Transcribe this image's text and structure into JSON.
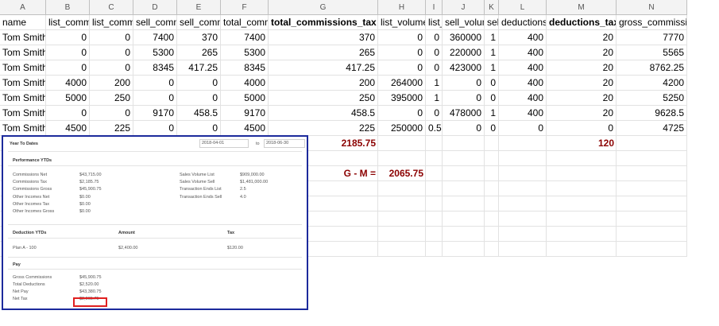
{
  "columns": [
    "A",
    "B",
    "C",
    "D",
    "E",
    "F",
    "G",
    "H",
    "I",
    "J",
    "K",
    "L",
    "M",
    "N"
  ],
  "header_row": [
    "name",
    "list_comm",
    "list_comm",
    "sell_comm",
    "sell_comm",
    "total_comm",
    "total_commissions_tax",
    "list_volume",
    "list_",
    "sell_volume",
    "sell_",
    "deductions",
    "deductions_tax",
    "gross_commission"
  ],
  "rows": [
    [
      "Tom Smith",
      "0",
      "0",
      "7400",
      "370",
      "7400",
      "370",
      "0",
      "0",
      "360000",
      "1",
      "400",
      "20",
      "7770"
    ],
    [
      "Tom Smith",
      "0",
      "0",
      "5300",
      "265",
      "5300",
      "265",
      "0",
      "0",
      "220000",
      "1",
      "400",
      "20",
      "5565"
    ],
    [
      "Tom Smith",
      "0",
      "0",
      "8345",
      "417.25",
      "8345",
      "417.25",
      "0",
      "0",
      "423000",
      "1",
      "400",
      "20",
      "8762.25"
    ],
    [
      "Tom Smith",
      "4000",
      "200",
      "0",
      "0",
      "4000",
      "200",
      "264000",
      "1",
      "0",
      "0",
      "400",
      "20",
      "4200"
    ],
    [
      "Tom Smith",
      "5000",
      "250",
      "0",
      "0",
      "5000",
      "250",
      "395000",
      "1",
      "0",
      "0",
      "400",
      "20",
      "5250"
    ],
    [
      "Tom Smith",
      "0",
      "0",
      "9170",
      "458.5",
      "9170",
      "458.5",
      "0",
      "0",
      "478000",
      "1",
      "400",
      "20",
      "9628.5"
    ],
    [
      "Tom Smith",
      "4500",
      "225",
      "0",
      "0",
      "4500",
      "225",
      "250000",
      "0.5",
      "0",
      "0",
      "0",
      "0",
      "4725"
    ]
  ],
  "sum_tax": "2185.75",
  "sum_deductions_tax": "120",
  "gm_label": "G - M =",
  "gm_value": "2065.75",
  "panel": {
    "title": "Year To Dates",
    "date_from": "2018-04-01",
    "to_label": "to",
    "date_to": "2018-06-30",
    "perf_title": "Performance YTDs",
    "perf_left": [
      {
        "label": "Commissions Net",
        "value": "$43,715.00"
      },
      {
        "label": "Commissions Tax",
        "value": "$2,185.75"
      },
      {
        "label": "Commissions Gross",
        "value": "$45,900.75"
      },
      {
        "label": "Other Incomes Net",
        "value": "$0.00"
      },
      {
        "label": "Other Incomes Tax",
        "value": "$0.00"
      },
      {
        "label": "Other Incomes Gross",
        "value": "$0.00"
      }
    ],
    "perf_right": [
      {
        "label": "Sales Volume List",
        "value": "$909,000.00"
      },
      {
        "label": "Sales Volume Sell",
        "value": "$1,481,000.00"
      },
      {
        "label": "Transaction Ends List",
        "value": "2.5"
      },
      {
        "label": "Transaction Ends Sell",
        "value": "4.0"
      }
    ],
    "ded_title": "Deduction YTDs",
    "ded_amount_header": "Amount",
    "ded_tax_header": "Tax",
    "ded_row": {
      "label": "Plan A - 100",
      "amount": "$2,400.00",
      "tax": "$120.00"
    },
    "pay_title": "Pay",
    "pay": [
      {
        "label": "Gross Commissions",
        "value": "$45,900.75"
      },
      {
        "label": "Total Deductions",
        "value": "$2,520.00"
      },
      {
        "label": "Net Pay",
        "value": "$43,380.75"
      },
      {
        "label": "Net Tax",
        "value": "$2,065.75"
      }
    ]
  }
}
